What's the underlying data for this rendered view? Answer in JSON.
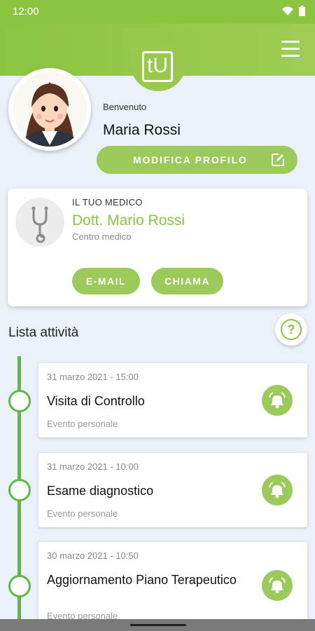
{
  "status_bar": {
    "time": "12:00"
  },
  "header": {
    "logo_text": "tU",
    "menu_icon": "hamburger-menu-icon",
    "accent_color": "#8bc53f"
  },
  "profile": {
    "welcome": "Benvenuto",
    "name": "Maria Rossi",
    "edit_label": "MODIFICA PROFILO",
    "edit_icon": "edit-icon"
  },
  "doctor": {
    "caption": "IL TUO MEDICO",
    "name": "Dott. Mario Rossi",
    "center": "Centro medico",
    "email_label": "E-MAIL",
    "call_label": "CHIAMA",
    "icon": "stethoscope-icon"
  },
  "activities": {
    "title": "Lista attività",
    "help_symbol": "?",
    "items": [
      {
        "date": "31 marzo 2021 - 15:00",
        "title": "Visita di Controllo",
        "type": "Evento personale",
        "icon": "alarm-icon"
      },
      {
        "date": "31 marzo 2021 - 10:00",
        "title": "Esame diagnostico",
        "type": "Evento personale",
        "icon": "alarm-icon"
      },
      {
        "date": "30 marzo 2021 - 10:50",
        "title": "Aggiornamento Piano Terapeutico",
        "type": "Evento personale",
        "icon": "alarm-icon"
      }
    ]
  }
}
